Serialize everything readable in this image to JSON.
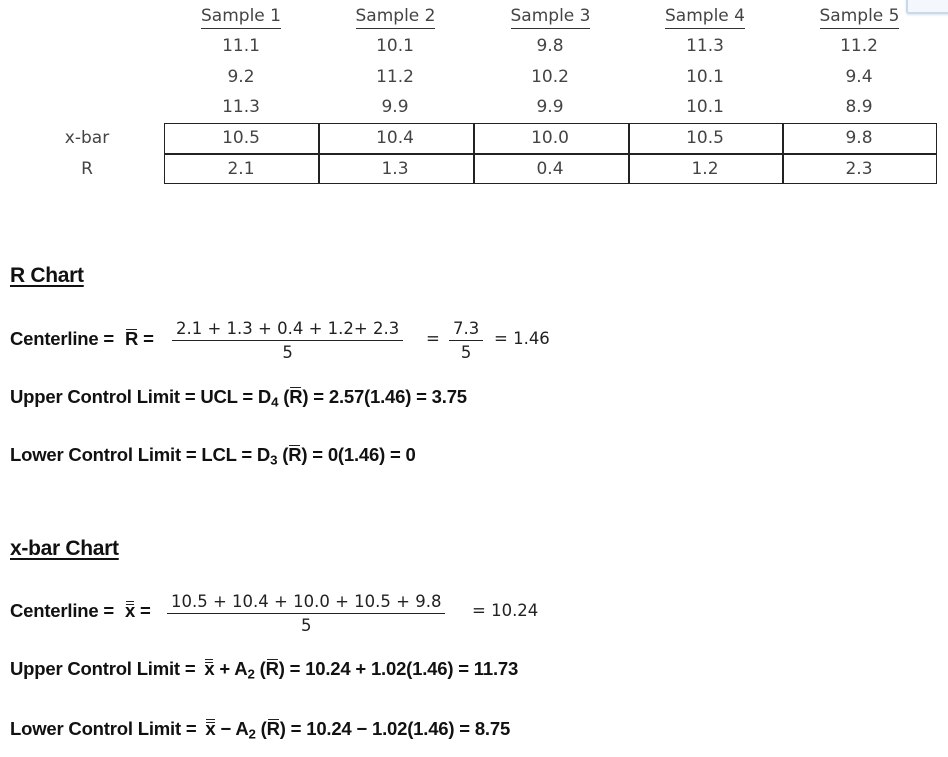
{
  "table": {
    "headers": [
      "Sample 1",
      "Sample 2",
      "Sample 3",
      "Sample 4",
      "Sample 5"
    ],
    "observations": [
      [
        "11.1",
        "10.1",
        "9.8",
        "11.3",
        "11.2"
      ],
      [
        "9.2",
        "11.2",
        "10.2",
        "10.1",
        "9.4"
      ],
      [
        "11.3",
        "9.9",
        "9.9",
        "10.1",
        "8.9"
      ]
    ],
    "xbar_label": "x-bar",
    "xbar": [
      "10.5",
      "10.4",
      "10.0",
      "10.5",
      "9.8"
    ],
    "r_label": "R",
    "r": [
      "2.1",
      "1.3",
      "0.4",
      "1.2",
      "2.3"
    ]
  },
  "r_chart": {
    "title": "R Chart",
    "centerline_label": "Centerline =",
    "centerline_symbol": "R",
    "centerline_eq": "=",
    "centerline_numerator": "2.1 + 1.3 + 0.4 + 1.2+ 2.3",
    "centerline_denominator": "5",
    "centerline_mid_eq": "=",
    "centerline_sum_numerator": "7.3",
    "centerline_sum_denominator": "5",
    "centerline_result": "= 1.46",
    "ucl_label": "Upper Control Limit = UCL = D",
    "ucl_sub": "4",
    "ucl_open": " (",
    "ucl_symbol": "R",
    "ucl_rest": ") = 2.57(1.46) = 3.75",
    "lcl_label": "Lower Control Limit = LCL = D",
    "lcl_sub": "3",
    "lcl_open": " (",
    "lcl_symbol": "R",
    "lcl_rest": ") = 0(1.46) = 0"
  },
  "xbar_chart": {
    "title": "x-bar Chart",
    "centerline_label": "Centerline =",
    "centerline_symbol": "x",
    "centerline_eq": "=",
    "centerline_numerator": "10.5 + 10.4 + 10.0 + 10.5 + 9.8",
    "centerline_denominator": "5",
    "centerline_result": "= 10.24",
    "ucl_label": "Upper Control Limit =",
    "ucl_symbol": "x",
    "ucl_op": " + A",
    "ucl_sub": "2",
    "ucl_open": " (",
    "ucl_r": "R",
    "ucl_rest": ") = 10.24 + 1.02(1.46) = 11.73",
    "lcl_label": "Lower Control Limit =",
    "lcl_symbol": "x",
    "lcl_op": " − A",
    "lcl_sub": "2",
    "lcl_open": " (",
    "lcl_r": "R",
    "lcl_rest": ") = 10.24 − 1.02(1.46) = 8.75"
  }
}
